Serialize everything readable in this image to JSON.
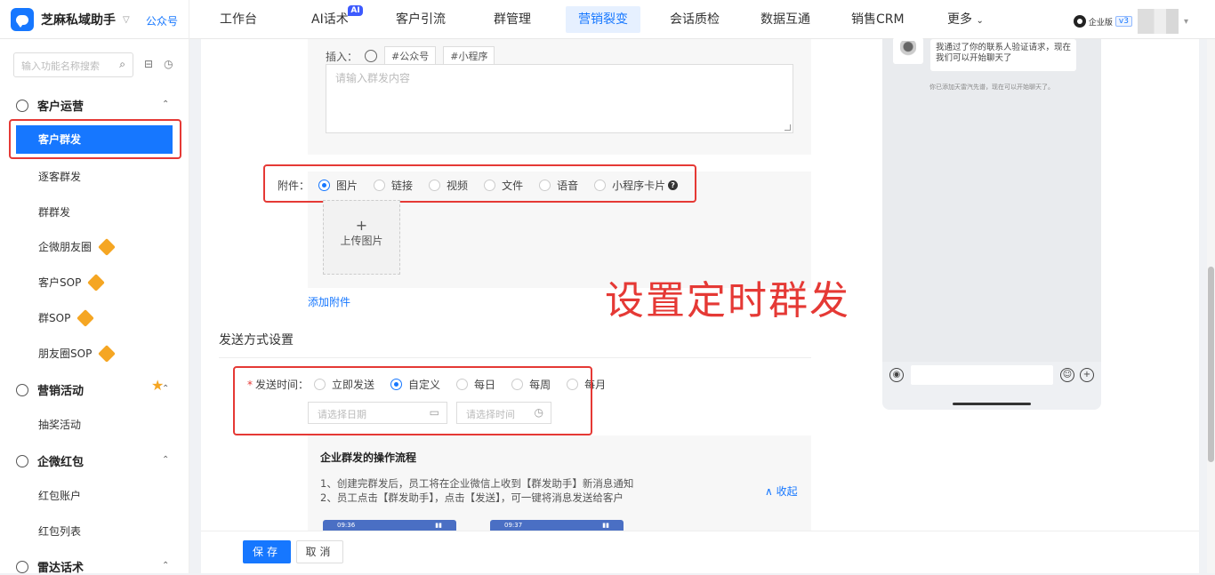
{
  "app": {
    "title": "芝麻私域助手",
    "account_switch": "公众号",
    "edition_label": "企业版",
    "version_tag": "v3"
  },
  "nav": {
    "items": [
      "工作台",
      "AI话术",
      "客户引流",
      "群管理",
      "营销裂变",
      "会话质检",
      "数据互通",
      "销售CRM",
      "更多"
    ],
    "active": "营销裂变",
    "ai_badge": "AI"
  },
  "sidebar": {
    "search_placeholder": "输入功能名称搜索",
    "groups": [
      {
        "title": "客户运营",
        "items": [
          "客户群发",
          "逐客群发",
          "群群发",
          "企微朋友圈",
          "客户SOP",
          "群SOP",
          "朋友圈SOP"
        ]
      },
      {
        "title": "营销活动",
        "items": [
          "抽奖活动"
        ]
      },
      {
        "title": "企微红包",
        "items": [
          "红包账户",
          "红包列表"
        ]
      },
      {
        "title": "雷达话术",
        "items": []
      }
    ],
    "active_item": "客户群发"
  },
  "form": {
    "insert_label": "插入：",
    "insert_tags": [
      "#公众号",
      "#小程序"
    ],
    "content_placeholder": "请输入群发内容",
    "attachment_label": "附件：",
    "attachment_options": [
      "图片",
      "链接",
      "视频",
      "文件",
      "语音",
      "小程序卡片"
    ],
    "attachment_selected": "图片",
    "upload_label": "上传图片",
    "add_attachment": "添加附件",
    "annotation": "设置定时群发",
    "send_section_title": "发送方式设置",
    "send_time_label": "发送时间：",
    "send_time_options": [
      "立即发送",
      "自定义",
      "每日",
      "每周",
      "每月"
    ],
    "send_time_selected": "自定义",
    "date_placeholder": "请选择日期",
    "time_placeholder": "请选择时间"
  },
  "flow": {
    "title": "企业群发的操作流程",
    "steps": [
      "1、创建完群发后，员工将在企业微信上收到【群发助手】新消息通知",
      "2、员工点击【群发助手】，点击【发送】，可一键将消息发送给客户"
    ],
    "collapse": "收起",
    "thumb_times": [
      "09:36",
      "09:37"
    ]
  },
  "preview": {
    "bubble_text": "我通过了你的联系人验证请求，现在我们可以开始聊天了",
    "system_text": "你已添加天雷汽先谱，现在可以开始聊天了。"
  },
  "footer": {
    "save": "保存",
    "cancel": "取消"
  }
}
